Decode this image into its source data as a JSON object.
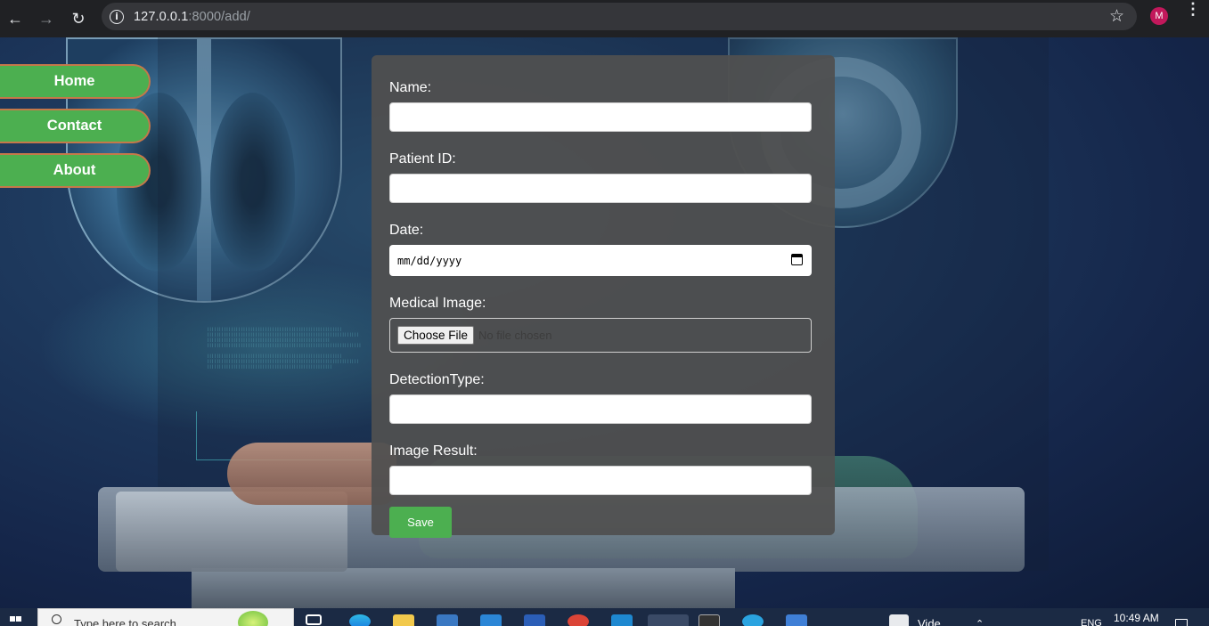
{
  "browser": {
    "url_host": "127.0.0.1",
    "url_path": ":8000/add/",
    "profile_initial": "M"
  },
  "sidebar": {
    "items": [
      {
        "label": "Home"
      },
      {
        "label": "Contact"
      },
      {
        "label": "About"
      }
    ]
  },
  "form": {
    "name_label": "Name:",
    "patient_id_label": "Patient ID:",
    "date_label": "Date:",
    "date_placeholder": "mm/dd/yyyy",
    "medical_image_label": "Medical Image:",
    "choose_file_label": "Choose File",
    "file_status": "No file chosen",
    "detection_type_label": "DetectionType:",
    "image_result_label": "Image Result:",
    "save_label": "Save"
  },
  "taskbar": {
    "search_placeholder": "Type here to search",
    "video_label": "Vide",
    "language": "ENG",
    "time": "10:49 AM"
  },
  "colors": {
    "accent_green": "#4caf50",
    "form_bg": "#505050",
    "chrome_bg": "#202124"
  }
}
